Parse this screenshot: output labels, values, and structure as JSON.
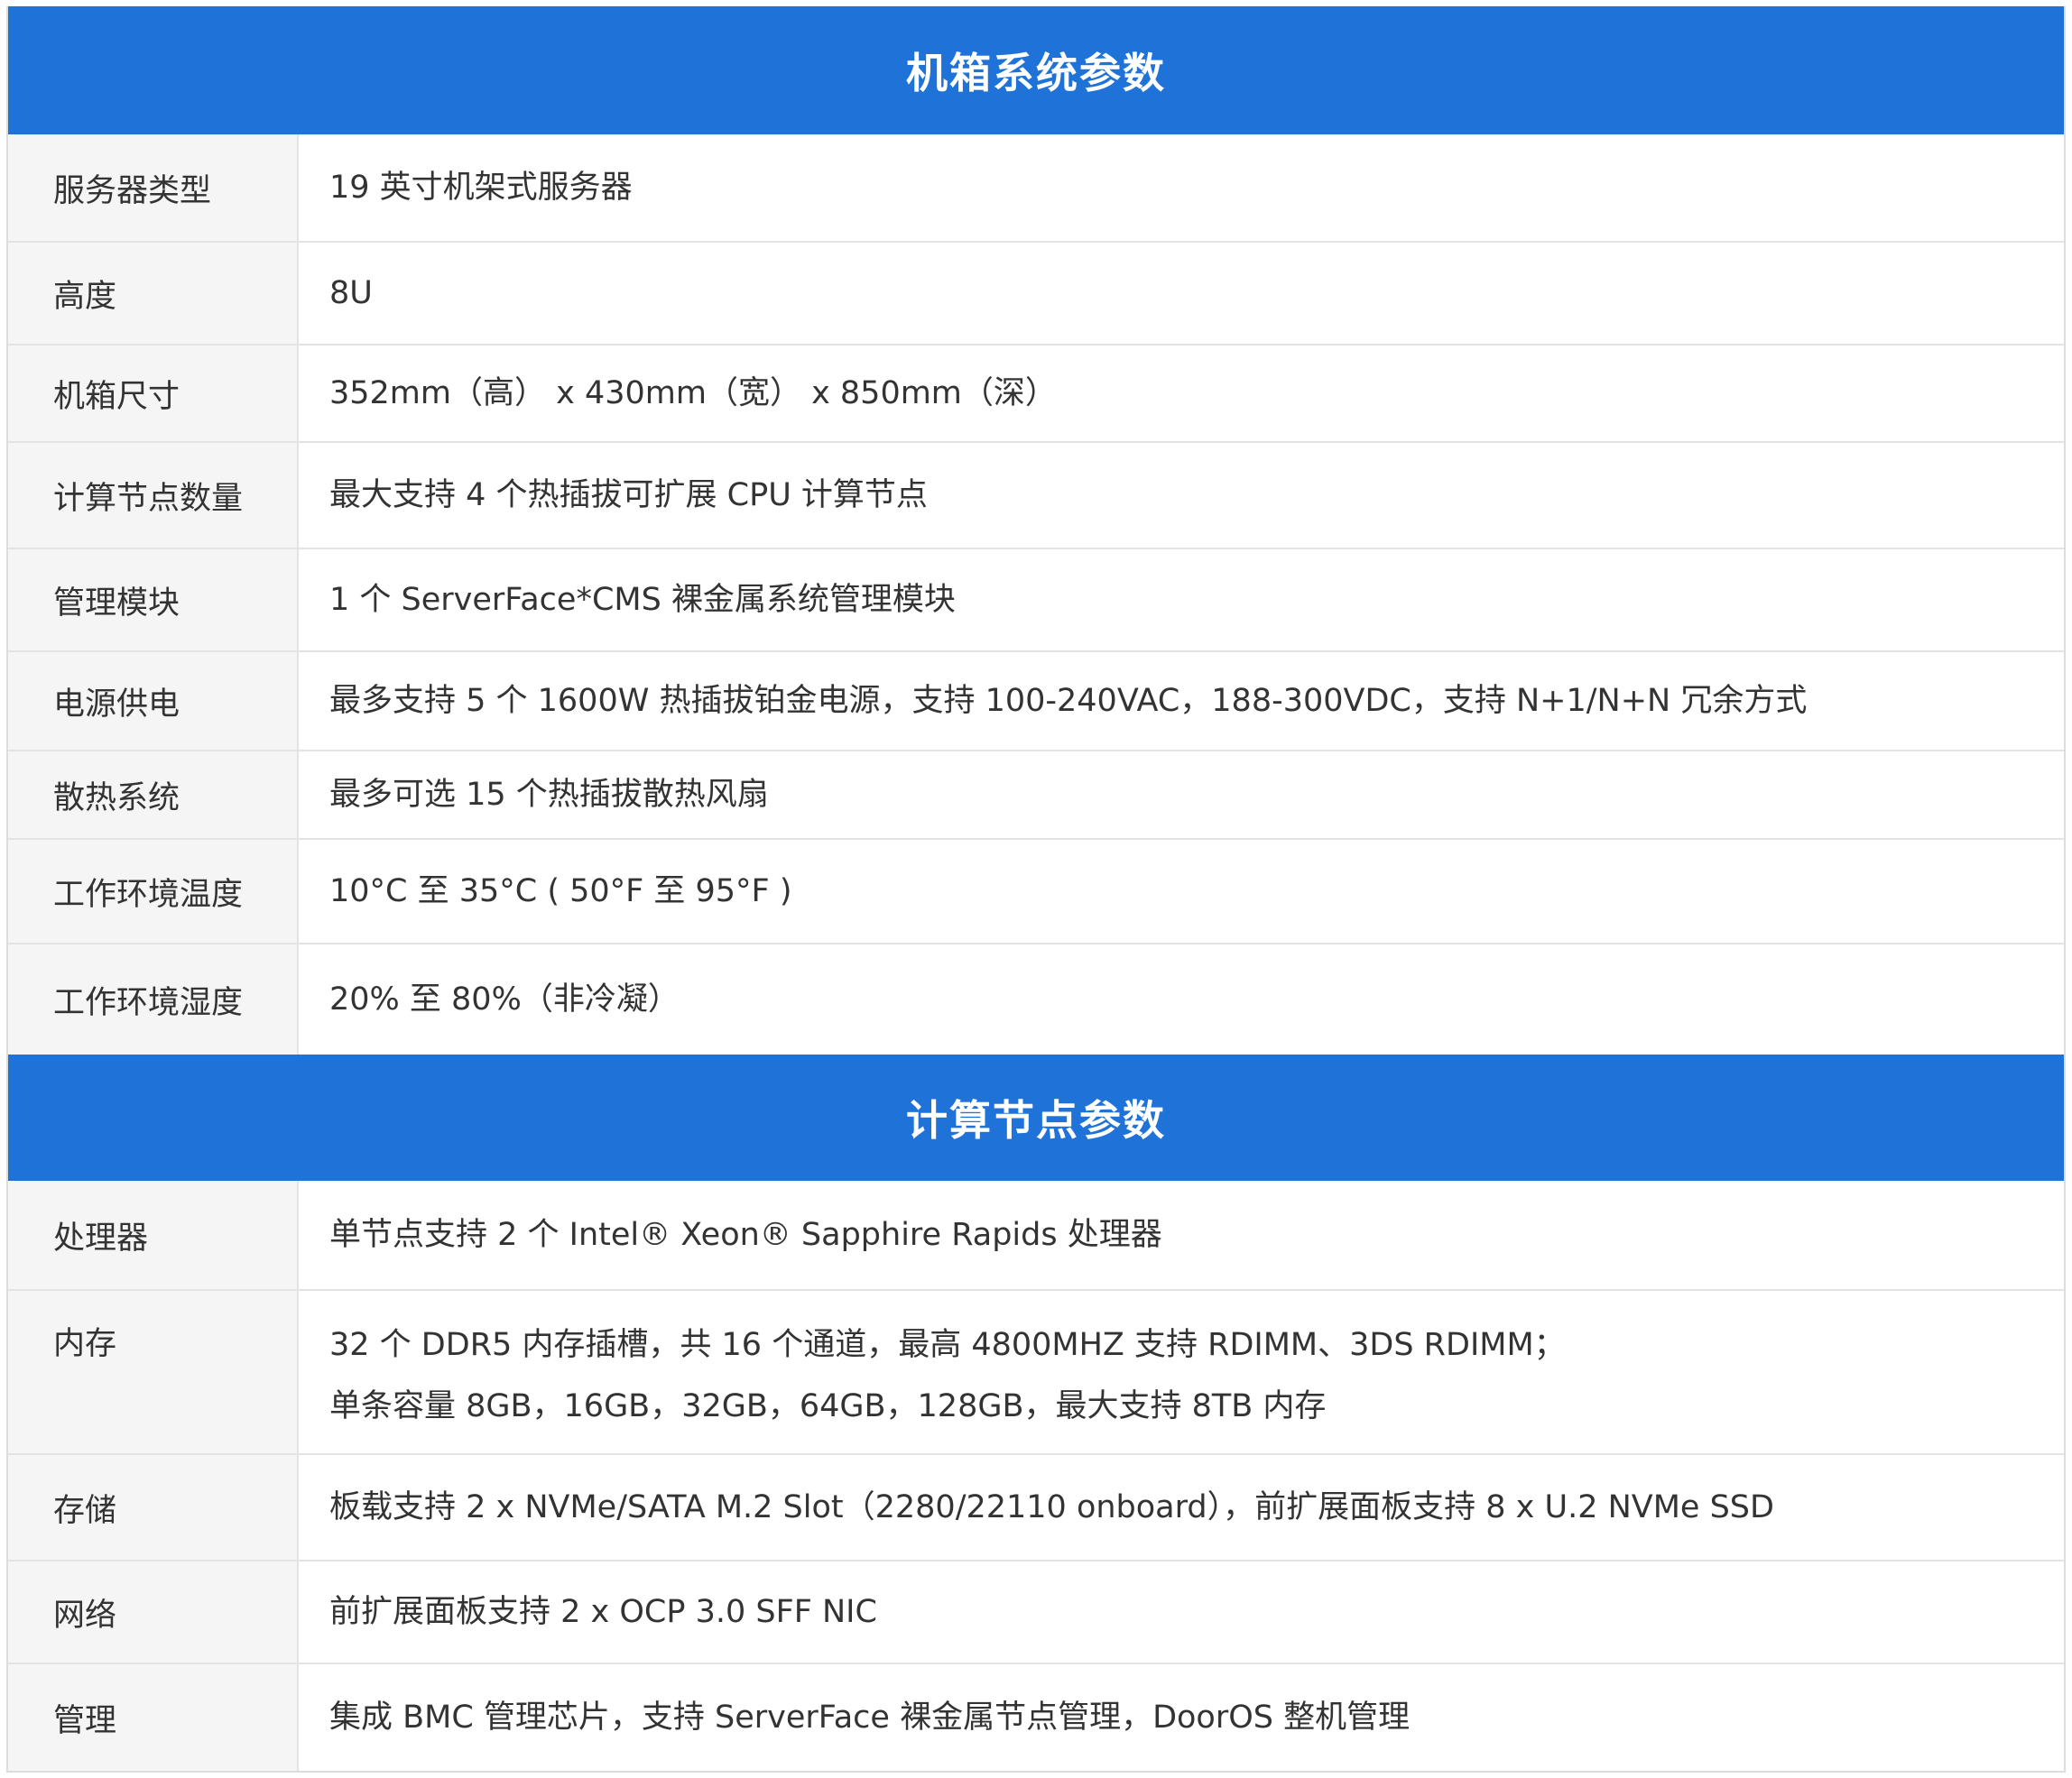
{
  "sections": [
    {
      "title": "机箱系统参数",
      "rows": [
        {
          "label": "服务器类型",
          "value": "19 英寸机架式服务器"
        },
        {
          "label": "高度",
          "value": "8U"
        },
        {
          "label": "机箱尺寸",
          "value": "352mm（高） x 430mm（宽） x 850mm（深）"
        },
        {
          "label": "计算节点数量",
          "value": "最大支持 4 个热插拔可扩展 CPU 计算节点"
        },
        {
          "label": "管理模块",
          "value": "1 个 ServerFace*CMS 裸金属系统管理模块"
        },
        {
          "label": "电源供电",
          "value": "最多支持 5 个 1600W 热插拔铂金电源，支持 100-240VAC，188-300VDC，支持 N+1/N+N 冗余方式"
        },
        {
          "label": "散热系统",
          "value": "最多可选 15 个热插拔散热风扇"
        },
        {
          "label": "工作环境温度",
          "value": "10°C 至 35°C ( 50°F 至 95°F )"
        },
        {
          "label": "工作环境湿度",
          "value": "20% 至 80%（非冷凝）"
        }
      ]
    },
    {
      "title": "计算节点参数",
      "rows": [
        {
          "label": "处理器",
          "value": "单节点支持 2 个 Intel® Xeon® Sapphire Rapids 处理器"
        },
        {
          "label": "内存",
          "value": "32 个 DDR5 内存插槽，共 16 个通道，最高 4800MHZ 支持 RDIMM、3DS RDIMM；",
          "value2": "单条容量 8GB，16GB，32GB，64GB，128GB，最大支持 8TB 内存"
        },
        {
          "label": "存储",
          "value": "板载支持 2 x NVMe/SATA M.2 Slot（2280/22110 onboard），前扩展面板支持 8 x U.2 NVMe SSD"
        },
        {
          "label": "网络",
          "value": "前扩展面板支持 2 x OCP 3.0 SFF NIC"
        },
        {
          "label": "管理",
          "value": "集成 BMC 管理芯片，支持 ServerFace 裸金属节点管理，DoorOS 整机管理"
        }
      ]
    }
  ]
}
